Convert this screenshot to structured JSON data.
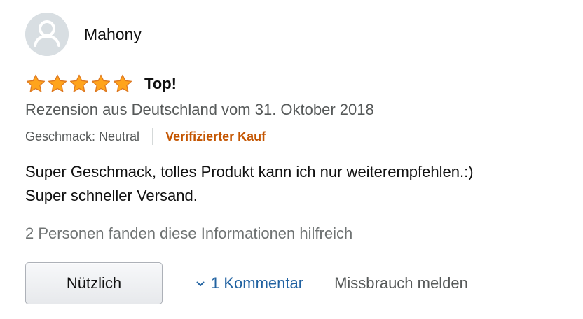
{
  "review": {
    "reviewer_name": "Mahony",
    "rating": 5,
    "max_rating": 5,
    "title": "Top!",
    "date_text": "Rezension aus Deutschland vom 31. Oktober 2018",
    "variant_text": "Geschmack: Neutral",
    "verified_text": "Verifizierter Kauf",
    "body_lines": [
      "Super Geschmack, tolles Produkt kann ich nur weiterempfehlen.:)",
      "Super schneller Versand."
    ],
    "helpful_text": "2 Personen fanden diese Informationen hilfreich"
  },
  "actions": {
    "helpful_button_label": "Nützlich",
    "comment_label": "1 Kommentar",
    "report_label": "Missbrauch melden"
  },
  "icons": {
    "avatar": "user-silhouette-icon",
    "star": "star-icon",
    "chevron": "chevron-down-icon"
  },
  "colors": {
    "star_fill": "#ffa41c",
    "star_stroke": "#de7921",
    "verified": "#c45500",
    "link": "#2162a1",
    "muted_text": "#565959",
    "avatar_bg": "#d8dee2"
  }
}
